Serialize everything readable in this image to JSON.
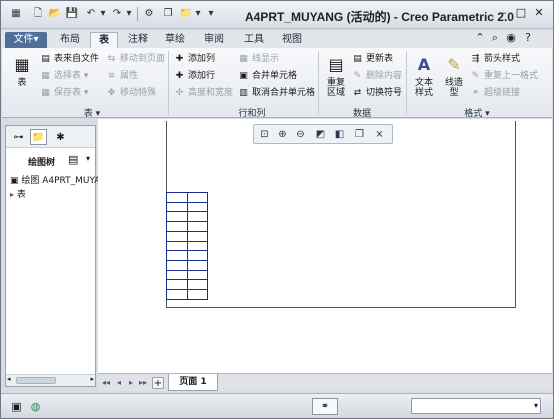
{
  "window": {
    "title": "A4PRT_MUYANG (活动的) - Creo Parametric 2.0",
    "controls": {
      "minimize": "–",
      "maximize": "□",
      "close": "✕"
    }
  },
  "quick_access": [
    {
      "name": "new-icon",
      "glyph": "🗋"
    },
    {
      "name": "open-icon",
      "glyph": "📂"
    },
    {
      "name": "save-icon",
      "glyph": "💾"
    },
    {
      "name": "undo-icon",
      "glyph": "↶"
    },
    {
      "name": "redo-icon",
      "glyph": "↷"
    },
    {
      "name": "regenerate-icon",
      "glyph": "⚙"
    },
    {
      "name": "windows-icon",
      "glyph": "❐"
    },
    {
      "name": "close-window-icon",
      "glyph": "✕"
    },
    {
      "name": "dropdown-icon",
      "glyph": "▾"
    }
  ],
  "tabs": {
    "file": "文件▾",
    "items": [
      "布局",
      "表",
      "注释",
      "草绘",
      "审阅",
      "工具",
      "视图"
    ],
    "active": "表"
  },
  "ribbon": {
    "table_group": {
      "label": "表 ▾",
      "big_button": "表",
      "from_file": "表来自文件",
      "select_table": "选择表 ▾",
      "save_table": "保存表 ▾",
      "move_to_page": "移动到页面",
      "properties": "属性",
      "move_special": "移动特殊"
    },
    "rows_cols_group": {
      "label": "行和列",
      "add_column": "添加列",
      "add_row": "添加行",
      "height_width": "高度和宽度",
      "line_display": "线显示",
      "merge_cells": "合并单元格",
      "unmerge_cells": "取消合并单元格"
    },
    "data_group": {
      "label": "数据",
      "repeat_region": "重复\n区域",
      "update_table": "更新表",
      "delete_content": "删除内容",
      "toggle_symbol": "切换符号"
    },
    "format_group": {
      "label": "格式 ▾",
      "text_style": "文本\n样式",
      "line_style": "线造\n型",
      "arrow_style": "箭头样式",
      "repeat_format": "重复上一格式",
      "hyperlink": "超级链接"
    }
  },
  "left_panel": {
    "tree_label": "绘图树",
    "rows": [
      "绘图 A4PRT_MUYA",
      "表"
    ]
  },
  "page_bar": {
    "page_label": "页面  1",
    "plus": "+"
  },
  "status": {
    "filter_value": ""
  },
  "colors": {
    "file_tab": "#4f6f98",
    "table_border": "#1d2d8c"
  }
}
